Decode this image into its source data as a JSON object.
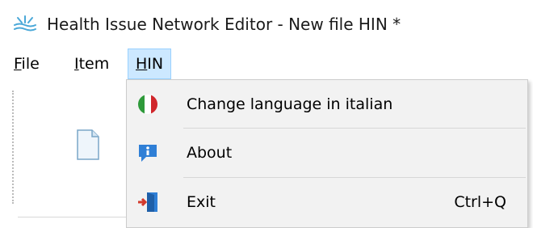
{
  "window": {
    "title": "Health Issue Network Editor - New file HIN *",
    "icon": "app-logo-icon"
  },
  "menubar": {
    "items": [
      {
        "prefix": "",
        "accel": "F",
        "rest": "ile"
      },
      {
        "prefix": "",
        "accel": "I",
        "rest": "tem"
      },
      {
        "prefix": "",
        "accel": "H",
        "rest": "IN"
      }
    ],
    "active_index": 2
  },
  "toolbar": {
    "icons": [
      "new-document-icon"
    ]
  },
  "hin_menu": {
    "items": [
      {
        "label": "Change language in italian",
        "icon": "italian-flag-icon",
        "shortcut": ""
      },
      {
        "label": "About",
        "icon": "info-icon",
        "shortcut": ""
      },
      {
        "label": "Exit",
        "icon": "exit-door-icon",
        "shortcut": "Ctrl+Q"
      }
    ]
  },
  "colors": {
    "menu_highlight": "#cce8ff",
    "menu_highlight_border": "#99d1ff",
    "dropdown_bg": "#f2f2f2",
    "flag_green": "#2e9a3a",
    "flag_red": "#d0262b",
    "info_blue": "#2f7fd6",
    "exit_red": "#d33a2c"
  }
}
